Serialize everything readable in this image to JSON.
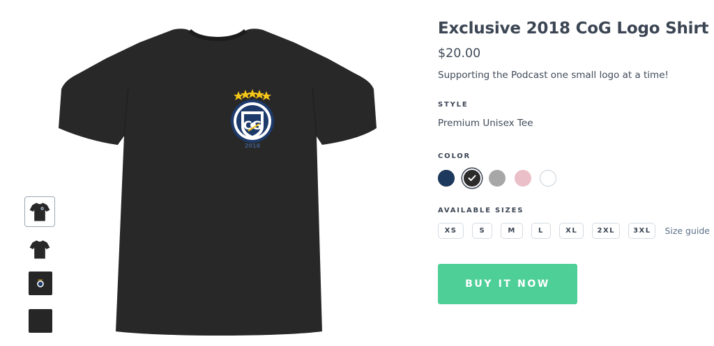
{
  "product": {
    "title": "Exclusive 2018 CoG Logo Shirt",
    "price": "$20.00",
    "description": "Supporting the Podcast one small logo at a time!"
  },
  "style": {
    "label": "STYLE",
    "value": "Premium Unisex Tee"
  },
  "color": {
    "label": "COLOR",
    "selected": "black",
    "options": [
      {
        "name": "navy",
        "hex": "#1d3a5e"
      },
      {
        "name": "black",
        "hex": "#2b2b2b"
      },
      {
        "name": "heather-grey",
        "hex": "#a7a7a7"
      },
      {
        "name": "pink",
        "hex": "#ebbfc8"
      },
      {
        "name": "white",
        "hex": "#ffffff"
      }
    ]
  },
  "sizes": {
    "label": "AVAILABLE SIZES",
    "options": [
      "XS",
      "S",
      "M",
      "L",
      "XL",
      "2XL",
      "3XL"
    ],
    "guide_label": "Size guide"
  },
  "buy_button": {
    "label": "BUY IT NOW",
    "color": "#4fcf98"
  },
  "logo": {
    "year": "2018",
    "shirt_color": "#282828",
    "accent_navy": "#1d3a6b",
    "star_color": "#f5c518"
  },
  "thumbnails": [
    "front-logo",
    "front-plain",
    "logo-closeup",
    "fabric-swatch"
  ]
}
